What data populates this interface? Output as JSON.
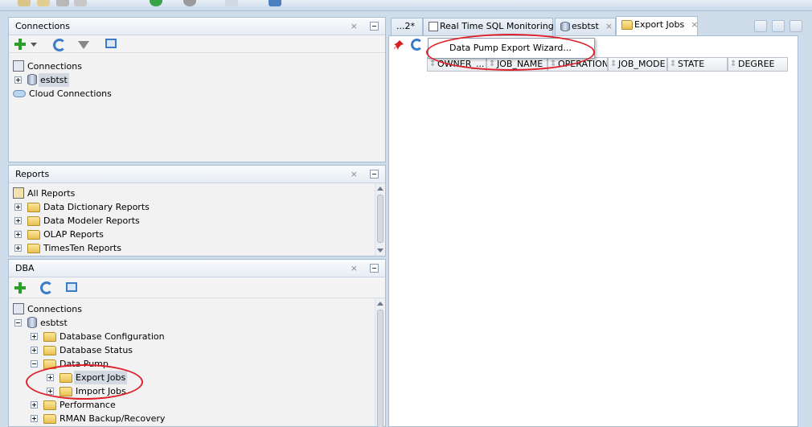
{
  "connections_panel": {
    "title": "Connections",
    "close": "×",
    "tree": {
      "root": "Connections",
      "child": "esbtst",
      "cloud": "Cloud Connections"
    }
  },
  "reports_panel": {
    "title": "Reports",
    "close": "×",
    "items": [
      "All Reports",
      "Data Dictionary Reports",
      "Data Modeler Reports",
      "OLAP Reports",
      "TimesTen Reports"
    ]
  },
  "dba_panel": {
    "title": "DBA",
    "close": "×",
    "tree": {
      "root": "Connections",
      "connection": "esbtst",
      "items": [
        "Database Configuration",
        "Database Status",
        "Data Pump",
        "Export Jobs",
        "Import Jobs",
        "Performance",
        "RMAN Backup/Recovery"
      ]
    }
  },
  "tabs": [
    {
      "label": "...2*"
    },
    {
      "label": "Real Time SQL Monitoring",
      "close": "×"
    },
    {
      "label": "esbtst",
      "close": "×"
    },
    {
      "label": "Export Jobs",
      "close": "×"
    }
  ],
  "grid": {
    "columns": [
      "OWNER_...",
      "JOB_NAME",
      "OPERATION",
      "JOB_MODE",
      "STATE",
      "DEGREE"
    ]
  },
  "context_menu": {
    "item": "Data Pump Export Wizard..."
  },
  "colors": {
    "highlight_ellipse": "#e0202a",
    "panel_border": "#a9bdd4"
  }
}
